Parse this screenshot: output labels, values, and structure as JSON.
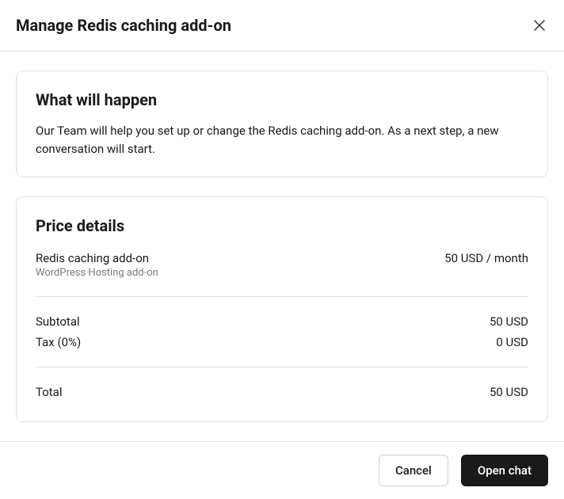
{
  "header": {
    "title": "Manage Redis caching add-on"
  },
  "info_card": {
    "heading": "What will happen",
    "body": "Our Team will help you set up or change the Redis caching add-on. As a next step, a new conversation will start."
  },
  "price_card": {
    "heading": "Price details",
    "line_item": {
      "name": "Redis caching add-on",
      "sub": "WordPress Hosting add-on",
      "amount": "50 USD / month"
    },
    "subtotal": {
      "label": "Subtotal",
      "amount": "50 USD"
    },
    "tax": {
      "label": "Tax (0%)",
      "amount": "0 USD"
    },
    "total": {
      "label": "Total",
      "amount": "50 USD"
    }
  },
  "footer": {
    "cancel": "Cancel",
    "open_chat": "Open chat"
  }
}
